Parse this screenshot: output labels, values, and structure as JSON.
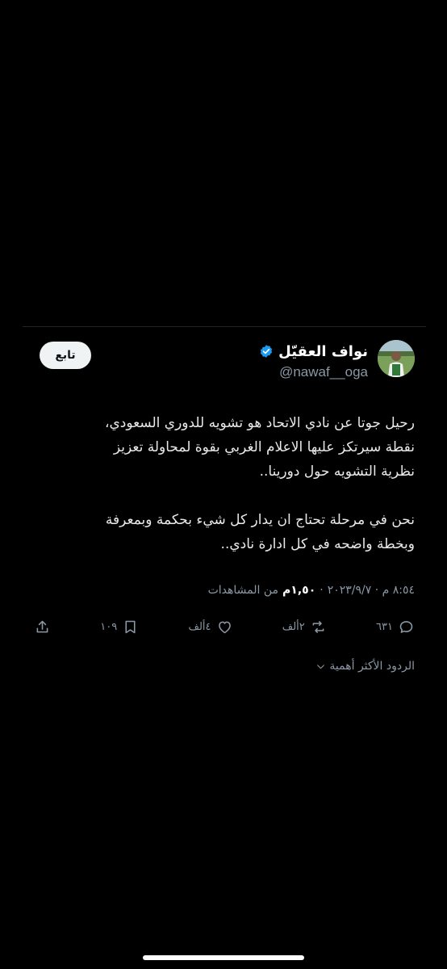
{
  "author": {
    "name": "نواف العقيّل",
    "handle": "@nawaf__oga",
    "verified_color": "#1d9bf0"
  },
  "follow_button": {
    "label": "تابع"
  },
  "tweet": {
    "paragraph_1": [
      "رحيل جوتا عن نادي الاتحاد هو تشويه للدوري السعودي،",
      "نقطة سيرتكز عليها الاعلام الغربي بقوة لمحاولة تعزيز",
      "نظرية التشويه حول دورينا.."
    ],
    "paragraph_2": [
      "نحن في مرحلة تحتاج ان يدار كل شيء بحكمة وبمعرفة",
      "وبخطة واضحه في كل ادارة نادي.."
    ]
  },
  "meta": {
    "datetime": "٨:٥٤ م · ٢٠٢٣/٩/٧",
    "separator": "·",
    "views_count": "١,٥٠م",
    "views_label": "من المشاهدات"
  },
  "actions": {
    "replies": {
      "icon": "reply-icon",
      "count": "٦٣١"
    },
    "retweets": {
      "icon": "retweet-icon",
      "count": "٢ألف"
    },
    "likes": {
      "icon": "heart-icon",
      "count": "٤ألف"
    },
    "bookmarks": {
      "icon": "bookmark-icon",
      "count": "١٠٩"
    },
    "share": {
      "icon": "share-icon"
    }
  },
  "replies_sort": {
    "label": "الردود الأكثر أهمية",
    "icon": "chevron-down-icon"
  },
  "colors": {
    "background": "#000000",
    "text": "#e7e9ea",
    "muted": "#8b98a5",
    "accent": "#1d9bf0"
  }
}
